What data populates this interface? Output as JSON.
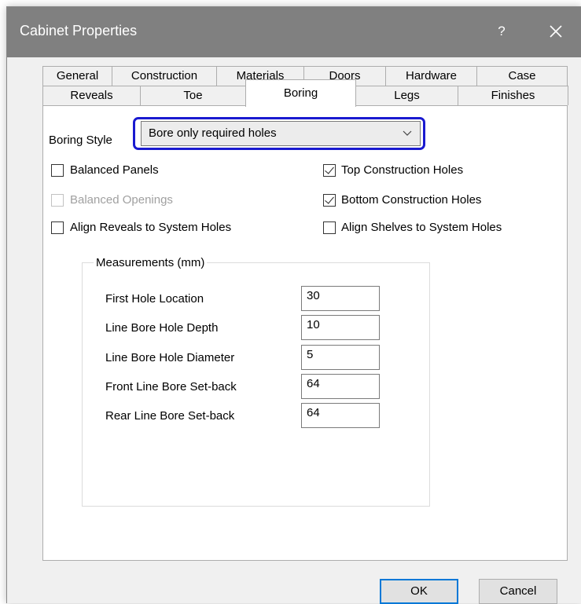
{
  "window": {
    "title": "Cabinet Properties",
    "help_label": "?"
  },
  "tabs": {
    "row1": [
      "General",
      "Construction",
      "Materials",
      "Doors",
      "Hardware",
      "Case"
    ],
    "row2": [
      "Reveals",
      "Toe",
      "Boring",
      "Legs",
      "Finishes"
    ],
    "active": "Boring"
  },
  "boring": {
    "style_label": "Boring Style",
    "style_value": "Bore only required holes"
  },
  "options": {
    "balanced_panels": {
      "label": "Balanced Panels",
      "checked": false
    },
    "balanced_openings": {
      "label": "Balanced Openings",
      "checked": false,
      "disabled": true
    },
    "align_reveals": {
      "label": "Align Reveals to System Holes",
      "checked": false
    },
    "top_construction": {
      "label": "Top Construction Holes",
      "checked": true
    },
    "bottom_construction": {
      "label": "Bottom Construction Holes",
      "checked": true
    },
    "align_shelves": {
      "label": "Align Shelves to System Holes",
      "checked": false
    }
  },
  "measurements": {
    "title": "Measurements (mm)",
    "fields": [
      {
        "label": "First Hole Location",
        "value": "30"
      },
      {
        "label": "Line Bore Hole Depth",
        "value": "10"
      },
      {
        "label": "Line Bore Hole Diameter",
        "value": "5"
      },
      {
        "label": "Front Line Bore Set-back",
        "value": "64"
      },
      {
        "label": "Rear Line Bore Set-back",
        "value": "64"
      }
    ]
  },
  "buttons": {
    "ok": "OK",
    "cancel": "Cancel"
  },
  "colors": {
    "titlebar": "#808080",
    "focus_ring": "#1a1ad0",
    "default_button_border": "#0078d7"
  }
}
